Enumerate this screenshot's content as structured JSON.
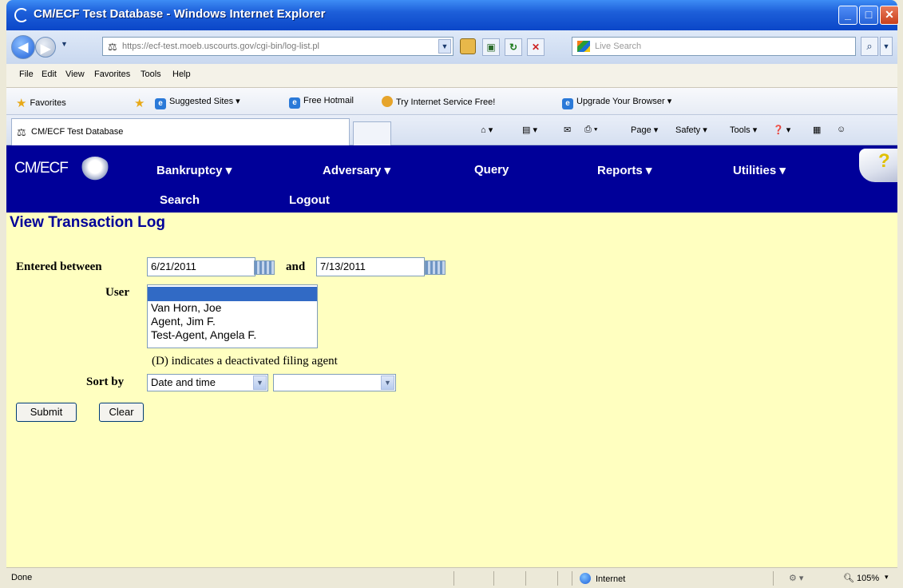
{
  "window": {
    "title": "CM/ECF Test Database - Windows Internet Explorer"
  },
  "addressbar": {
    "url": "https://ecf-test.moeb.uscourts.gov/cgi-bin/log-list.pl",
    "search_placeholder": "Live Search"
  },
  "menubar": {
    "items": [
      "File",
      "Edit",
      "View",
      "Favorites",
      "Tools",
      "Help"
    ]
  },
  "favbar": {
    "favorites_label": "Favorites",
    "links": [
      "Suggested Sites ▾",
      "Free Hotmail",
      "Try Internet Service Free!",
      "Upgrade Your Browser ▾"
    ]
  },
  "tab": {
    "title": "CM/ECF Test Database"
  },
  "commandbar": {
    "items": [
      "Page ▾",
      "Safety ▾",
      "Tools ▾"
    ]
  },
  "ecf": {
    "logo": "CM/ECF",
    "nav": [
      "Bankruptcy ▾",
      "Adversary ▾",
      "Query",
      "Reports ▾",
      "Utilities ▾",
      "Search",
      "Logout"
    ]
  },
  "page": {
    "title": "View Transaction Log",
    "entered_between_label": "Entered between",
    "and_label": "and",
    "date_from": "6/21/2011",
    "date_to": "7/13/2011",
    "user_label": "User",
    "users": [
      "Van Horn, Joe",
      "Agent, Jim F.",
      "Test-Agent, Angela F."
    ],
    "deactivated_note": "(D) indicates a deactivated filing agent",
    "sort_label": "Sort by",
    "sort_value": "Date and time",
    "sort_secondary": "",
    "submit_label": "Submit",
    "clear_label": "Clear"
  },
  "statusbar": {
    "status": "Done",
    "zone": "Internet",
    "zoom": "105%"
  },
  "colors": {
    "nav_bg": "#000099",
    "page_bg": "#ffffc0",
    "title_blue": "#000099",
    "selection": "#316ac5"
  }
}
